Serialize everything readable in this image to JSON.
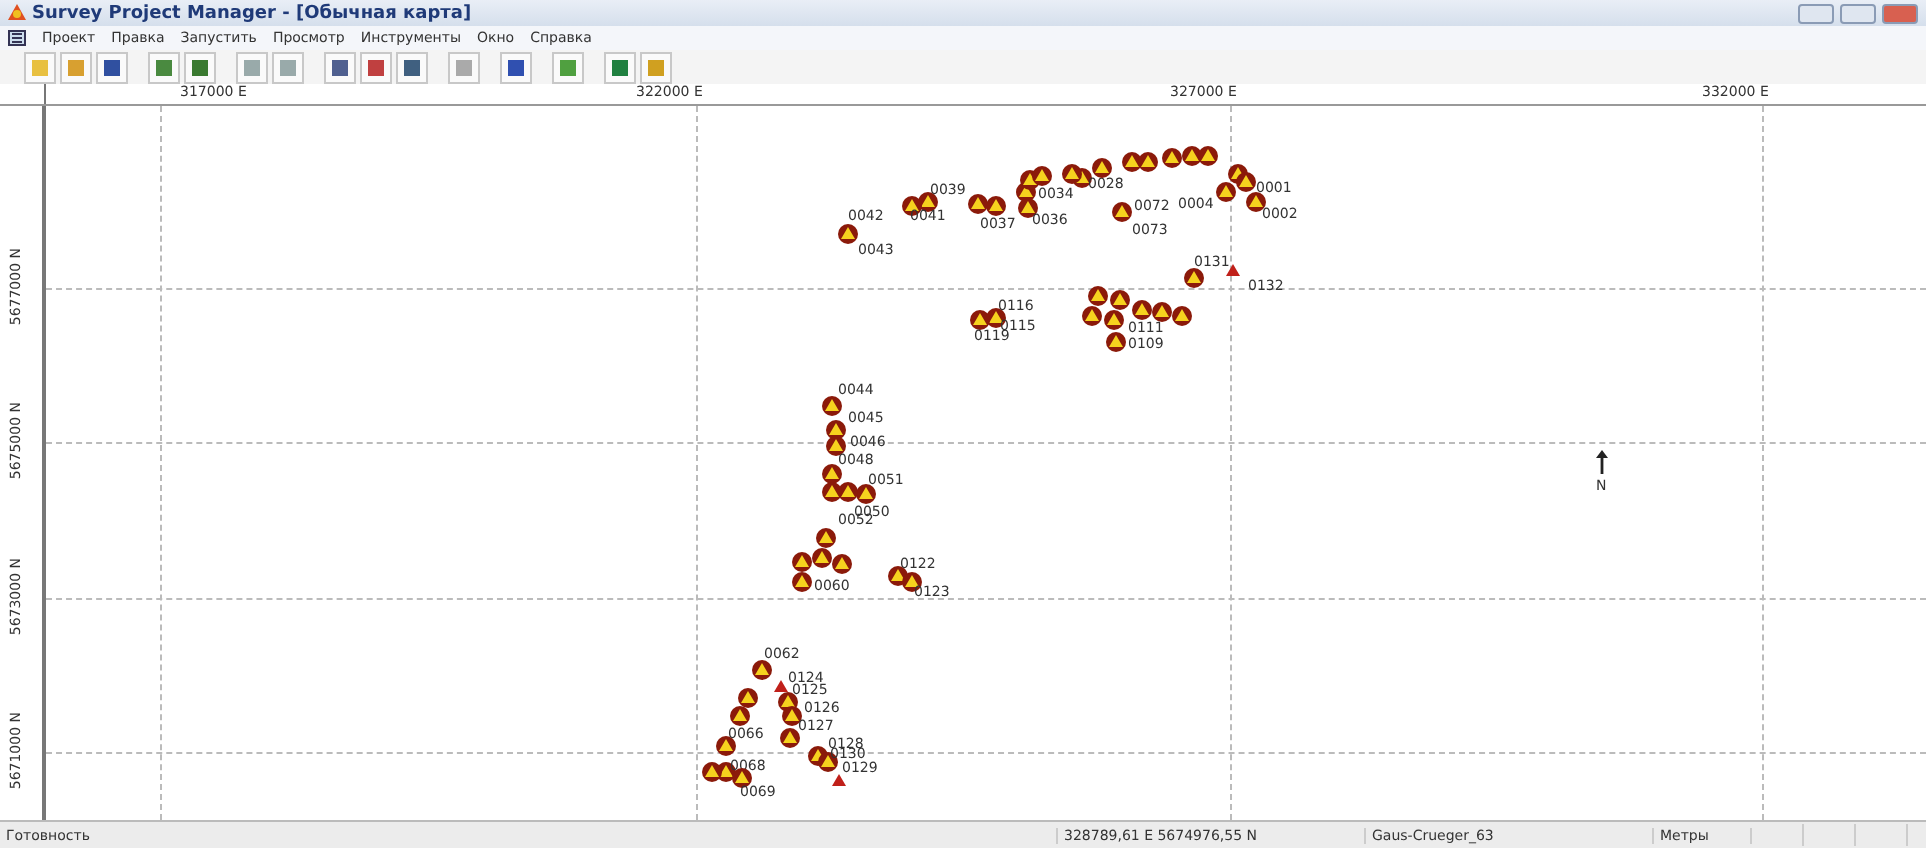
{
  "window": {
    "title": "Survey Project Manager - [Обычная карта]"
  },
  "menu": [
    "Проект",
    "Правка",
    "Запустить",
    "Просмотр",
    "Инструменты",
    "Окно",
    "Справка"
  ],
  "x_axis": [
    "317000 E",
    "322000 E",
    "327000 E",
    "332000 E"
  ],
  "y_axis": [
    "5677000 N",
    "5675000 N",
    "5673000 N",
    "5671000 N"
  ],
  "north_label": "N",
  "points": [
    {
      "label": "0042",
      "kind": "station"
    },
    {
      "label": "0043"
    },
    {
      "label": "0039",
      "kind": "station"
    },
    {
      "label": "0041",
      "kind": "station"
    },
    {
      "label": "0037",
      "kind": "station"
    },
    {
      "label": "0034",
      "kind": "station"
    },
    {
      "label": "0036",
      "kind": "station"
    },
    {
      "label": "0028",
      "kind": "station"
    },
    {
      "label": "0072",
      "kind": "station"
    },
    {
      "label": "0073"
    },
    {
      "label": "0004",
      "kind": "station"
    },
    {
      "label": "0001",
      "kind": "station"
    },
    {
      "label": "0002"
    },
    {
      "label": "0131",
      "kind": "station"
    },
    {
      "label": "0132",
      "kind": "target"
    },
    {
      "label": "0116",
      "kind": "station"
    },
    {
      "label": "0115",
      "kind": "station"
    },
    {
      "label": "0119"
    },
    {
      "label": "0111",
      "kind": "station"
    },
    {
      "label": "0109",
      "kind": "station"
    },
    {
      "label": "0044",
      "kind": "station"
    },
    {
      "label": "0045",
      "kind": "station"
    },
    {
      "label": "0046",
      "kind": "station"
    },
    {
      "label": "0048",
      "kind": "station"
    },
    {
      "label": "0051",
      "kind": "station"
    },
    {
      "label": "0050",
      "kind": "station"
    },
    {
      "label": "0052",
      "kind": "station"
    },
    {
      "label": "0060",
      "kind": "station"
    },
    {
      "label": "0122",
      "kind": "station"
    },
    {
      "label": "0123",
      "kind": "station"
    },
    {
      "label": "0062",
      "kind": "station"
    },
    {
      "label": "0124",
      "kind": "target"
    },
    {
      "label": "0125",
      "kind": "station"
    },
    {
      "label": "0126",
      "kind": "station"
    },
    {
      "label": "0127",
      "kind": "station"
    },
    {
      "label": "0066",
      "kind": "station"
    },
    {
      "label": "0128",
      "kind": "station"
    },
    {
      "label": "0130",
      "kind": "station"
    },
    {
      "label": "0129",
      "kind": "target"
    },
    {
      "label": "0068",
      "kind": "station"
    },
    {
      "label": "0069",
      "kind": "station"
    },
    {
      "kind": "station"
    },
    {
      "kind": "station"
    },
    {
      "kind": "station"
    },
    {
      "kind": "station"
    },
    {
      "kind": "station"
    },
    {
      "kind": "station"
    },
    {
      "kind": "station"
    },
    {
      "kind": "station"
    },
    {
      "kind": "station"
    },
    {
      "kind": "station"
    },
    {
      "kind": "station"
    },
    {
      "kind": "station"
    },
    {
      "kind": "station"
    },
    {
      "kind": "station"
    },
    {
      "kind": "station"
    },
    {
      "kind": "station"
    },
    {
      "kind": "station"
    },
    {
      "kind": "station"
    },
    {
      "kind": "station"
    },
    {
      "kind": "station"
    },
    {
      "kind": "station"
    },
    {
      "kind": "station"
    },
    {
      "kind": "station"
    },
    {
      "kind": "station"
    },
    {
      "kind": "station"
    }
  ],
  "status_bar": {
    "state": "Готовность",
    "coordinates": "328789,61 E 5674976,55 N",
    "projection": "Gaus-Crueger_63",
    "units": "Метры"
  }
}
